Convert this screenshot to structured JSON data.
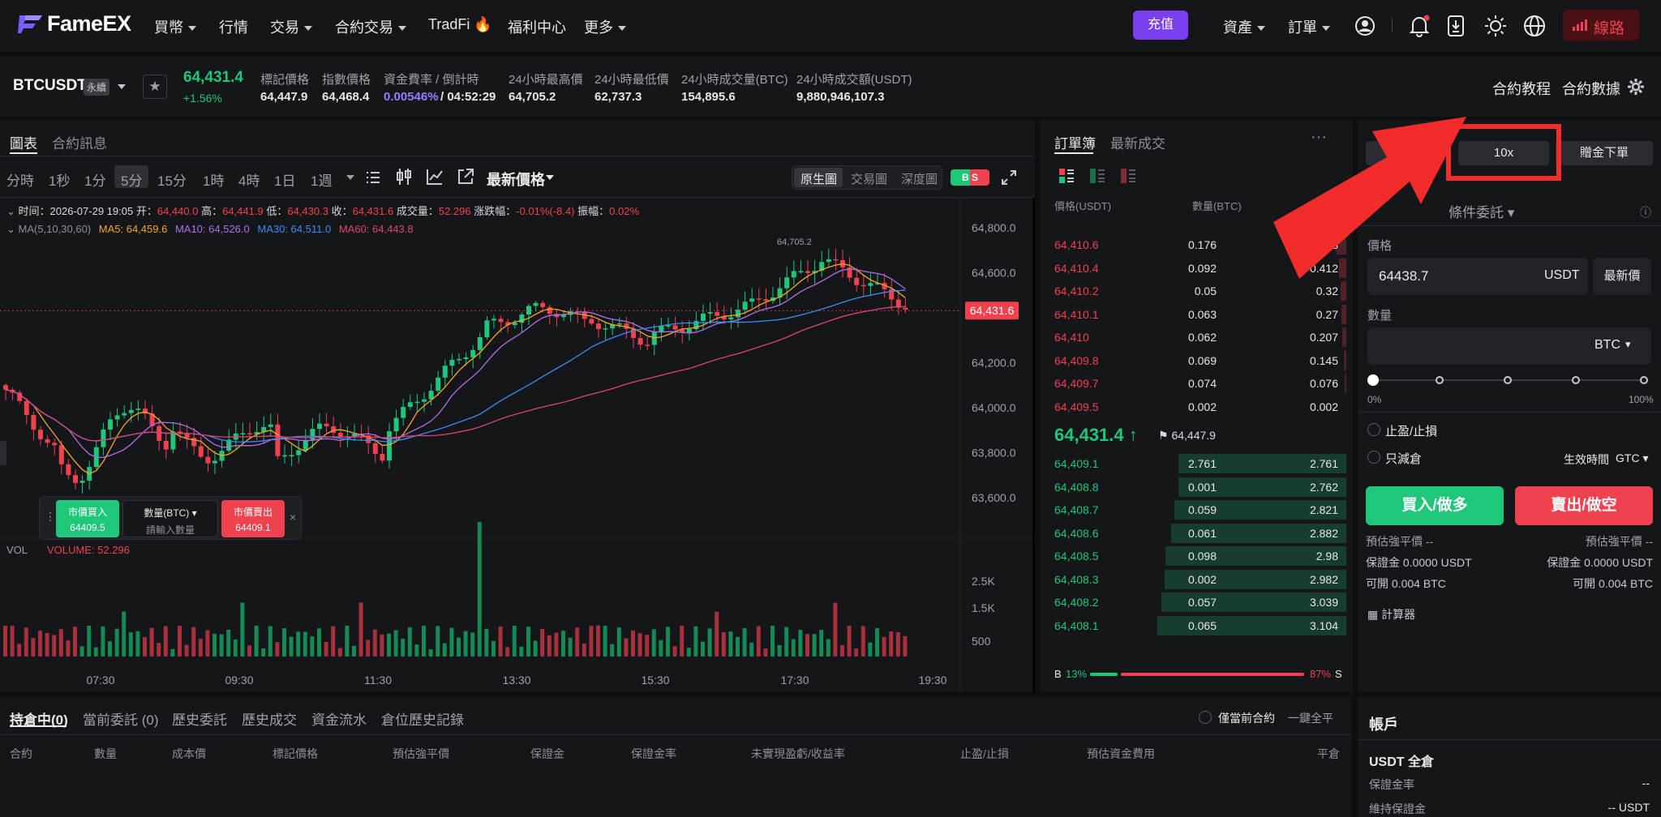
{
  "brand": {
    "name": "FameEX"
  },
  "nav": {
    "items": [
      "買幣",
      "行情",
      "交易",
      "合約交易",
      "TradFi",
      "福利中心",
      "更多"
    ],
    "deposit": "充值",
    "assets": "資產",
    "orders": "訂單",
    "line": "線路"
  },
  "ticker": {
    "symbol": "BTCUSDT",
    "perp": "永續",
    "price": "64,431.4",
    "change": "+1.56%",
    "fields": [
      {
        "label": "標記價格",
        "value": "64,447.9"
      },
      {
        "label": "指數價格",
        "value": "64,468.4"
      },
      {
        "label": "資金費率 / 倒計時",
        "value": "0.00546%",
        "value2": "/ 04:52:29"
      },
      {
        "label": "24小時最高價",
        "value": "64,705.2"
      },
      {
        "label": "24小時最低價",
        "value": "62,737.3"
      },
      {
        "label": "24小時成交量(BTC)",
        "value": "154,895.6"
      },
      {
        "label": "24小時成交額(USDT)",
        "value": "9,880,946,107.3"
      }
    ],
    "tutorial": "合約教程",
    "contract_data": "合約數據"
  },
  "chart": {
    "tabs": [
      "圖表",
      "合約訊息"
    ],
    "timeframes": [
      "分時",
      "1秒",
      "1分",
      "5分",
      "15分",
      "1時",
      "4時",
      "1日",
      "1週"
    ],
    "active_tf": "5分",
    "price_type": "最新價格",
    "views": [
      "原生圖",
      "交易圖",
      "深度圖"
    ],
    "bs": "B S",
    "ohlc": {
      "time_l": "时间：",
      "time": "2026-07-29 19:05",
      "o_l": "开：",
      "o": "64,440.0",
      "h_l": "高：",
      "h": "64,441.9",
      "l_l": "低：",
      "l": "64,430.3",
      "c_l": "收：",
      "c": "64,431.6",
      "vol_l": "成交量：",
      "vol": "52.296",
      "chg_l": "涨跌幅：",
      "chg": "-0.01%(-8.4)",
      "amp_l": "振幅：",
      "amp": "0.02%"
    },
    "ma": {
      "label": "MA(5,10,30,60)",
      "ma5": "MA5: 64,459.6",
      "ma10": "MA10: 64,526.0",
      "ma30": "MA30: 64,511.0",
      "ma60": "MA60: 64,443.8"
    },
    "peak_label": "64,705.2",
    "y_ticks": [
      "64,800.0",
      "64,600.0",
      "64,200.0",
      "64,000.0",
      "63,800.0",
      "63,600.0"
    ],
    "current_price_tag": "64,431.6",
    "vol_label": "VOL",
    "vol_value": "VOLUME: 52.296",
    "vol_ticks": [
      "2.5K",
      "1.5K",
      "500"
    ],
    "x_ticks": [
      "07:30",
      "09:30",
      "11:30",
      "13:30",
      "15:30",
      "17:30",
      "19:30"
    ],
    "quick": {
      "buy": "市價買入",
      "buy_price": "64409.5",
      "qty": "數量(BTC)",
      "qty_ph": "請輸入數量",
      "sell": "市價賣出",
      "sell_price": "64409.1"
    }
  },
  "orderbook": {
    "tabs": [
      "訂單簿",
      "最新成交"
    ],
    "col_price": "價格(USDT)",
    "col_qty": "數量(BTC)",
    "asks": [
      [
        "64,410.6",
        "0.176",
        "0.588"
      ],
      [
        "64,410.4",
        "0.092",
        "0.412"
      ],
      [
        "64,410.2",
        "0.05",
        "0.32"
      ],
      [
        "64,410.1",
        "0.063",
        "0.27"
      ],
      [
        "64,410",
        "0.062",
        "0.207"
      ],
      [
        "64,409.8",
        "0.069",
        "0.145"
      ],
      [
        "64,409.7",
        "0.074",
        "0.076"
      ],
      [
        "64,409.5",
        "0.002",
        "0.002"
      ]
    ],
    "last": "64,431.4",
    "last_arrow": "↑",
    "mark": "64,447.9",
    "bids": [
      [
        "64,409.1",
        "2.761",
        "2.761"
      ],
      [
        "64,408.8",
        "0.001",
        "2.762"
      ],
      [
        "64,408.7",
        "0.059",
        "2.821"
      ],
      [
        "64,408.6",
        "0.061",
        "2.882"
      ],
      [
        "64,408.5",
        "0.098",
        "2.98"
      ],
      [
        "64,408.3",
        "0.002",
        "2.982"
      ],
      [
        "64,408.2",
        "0.057",
        "3.039"
      ],
      [
        "64,408.1",
        "0.065",
        "3.104"
      ]
    ],
    "b_pct": "13%",
    "s_pct": "87%",
    "b": "B",
    "s": "S"
  },
  "trade": {
    "leverage": "10x",
    "bonus": "贈金下單",
    "cond": "條件委託",
    "price_label": "價格",
    "price_value": "64438.7",
    "usdt": "USDT",
    "latest": "最新價",
    "qty_label": "數量",
    "btc": "BTC",
    "slider_min": "0%",
    "slider_max": "100%",
    "tpsl": "止盈/止損",
    "reduce": "只減倉",
    "tif": "生效時間",
    "gtc": "GTC",
    "buy": "買入/做多",
    "sell": "賣出/做空",
    "liq_l": "預估強平價 --",
    "liq_r": "預估強平價 --",
    "margin_l": "保證金 0.0000 USDT",
    "margin_r": "保證金 0.0000 USDT",
    "avail_l": "可開 0.004 BTC",
    "avail_r": "可開 0.004 BTC",
    "calc": "計算器"
  },
  "positions": {
    "tabs": [
      "持倉中(0)",
      "當前委託 (0)",
      "歷史委託",
      "歷史成交",
      "資金流水",
      "倉位歷史記錄"
    ],
    "only_current": "僅當前合約",
    "close_all": "一鍵全平",
    "cols": [
      "合約",
      "數量",
      "成本價",
      "標記價格",
      "預估強平價",
      "保證金",
      "保證金率",
      "未實現盈虧/收益率",
      "止盈/止損",
      "預估資金費用",
      "平倉"
    ]
  },
  "account": {
    "title": "帳戶",
    "mode": "USDT 全倉",
    "margin_rate": "保證金率",
    "margin_rate_v": "--",
    "maint": "維持保證金",
    "maint_v": "-- USDT"
  }
}
